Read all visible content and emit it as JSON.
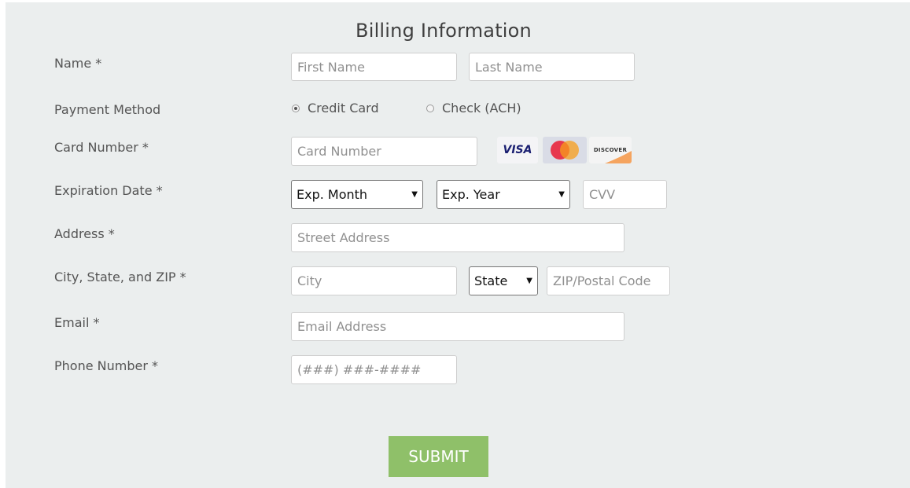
{
  "form": {
    "title": "Billing Information",
    "name_label": "Name *",
    "first_name_placeholder": "First Name",
    "last_name_placeholder": "Last Name",
    "payment_label": "Payment Method",
    "payment_options": [
      "Credit Card",
      "Check (ACH)"
    ],
    "payment_selected": "Credit Card",
    "card_label": "Card Number *",
    "card_placeholder": "Card Number",
    "card_logos": [
      "VISA",
      "MasterCard",
      "DISCOVER"
    ],
    "expiration_label": "Expiration Date *",
    "exp_month": "Exp. Month",
    "exp_year": "Exp. Year",
    "cvv_placeholder": "CVV",
    "address_label": "Address *",
    "street_placeholder": "Street Address",
    "city_state_zip_label": "City, State, and ZIP *",
    "city_placeholder": "City",
    "state_value": "State",
    "zip_placeholder": "ZIP/Postal Code",
    "email_label": "Email *",
    "email_placeholder": "Email Address",
    "phone_label": "Phone Number *",
    "phone_placeholder": "(###) ###-####",
    "submit_label": "SUBMIT"
  },
  "colors": {
    "panel_bg": "#ebeeee",
    "submit_bg": "#8fc069",
    "visa": "#1a1f71",
    "mastercard_red": "#eb001b",
    "mastercard_orange": "#f79e1b",
    "discover_orange": "#f58220"
  }
}
